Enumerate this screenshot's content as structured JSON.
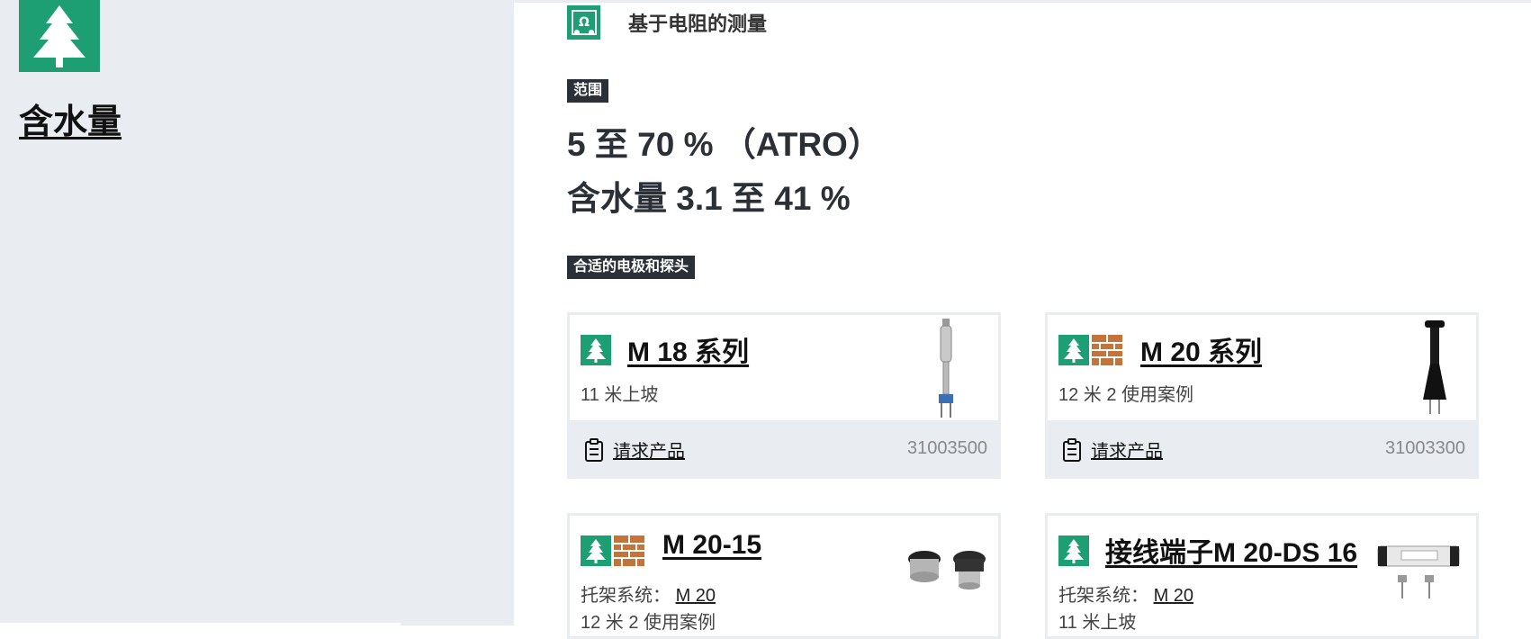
{
  "sidebar": {
    "icon": "tree-icon",
    "title": "含水量"
  },
  "method": {
    "icon": "ohm-icon",
    "label": "基于电阻的测量"
  },
  "range": {
    "tag": "范围",
    "line1": "5 至 70 % （ATRO）",
    "line2": "含水量 3.1 至 41 %"
  },
  "probes": {
    "tag": "合适的电极和探头",
    "cards": [
      {
        "name": "M 18 系列",
        "sub": "11 米上坡",
        "request": "请求产品",
        "code": "31003500",
        "icons": [
          "tree-icon"
        ]
      },
      {
        "name": "M 20 系列",
        "sub": "12 米  2 使用案例",
        "request": "请求产品",
        "code": "31003300",
        "icons": [
          "tree-icon",
          "brick-icon"
        ]
      },
      {
        "name": "M 20-15",
        "sub_label": "托架系统：",
        "sub_link": "M 20",
        "sub2": "12 米  2 使用案例",
        "icons": [
          "tree-icon",
          "brick-icon"
        ]
      },
      {
        "name": "接线端子M 20-DS 16",
        "sub_label": "托架系统：",
        "sub_link": "M 20",
        "sub2": "11 米上坡",
        "icons": [
          "tree-icon"
        ]
      }
    ]
  },
  "colors": {
    "wood_green": "#1e9e73",
    "brick_orange": "#c2743a",
    "sidebar_bg": "#e9edf2",
    "tag_bg": "#2b2f36"
  }
}
